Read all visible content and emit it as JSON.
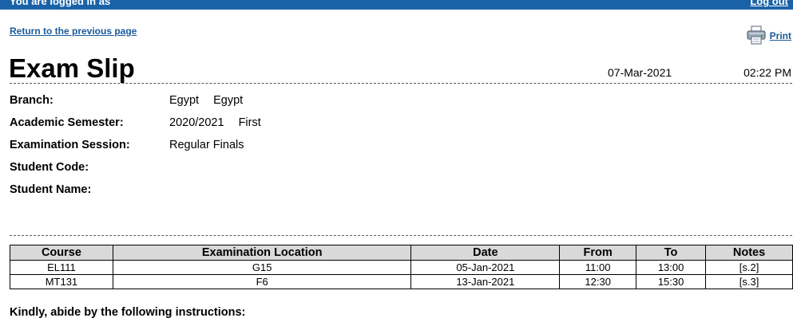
{
  "topbar": {
    "logged_in_text": "You are logged in as",
    "logout_label": "Log out",
    "color": "#1a62a8"
  },
  "nav": {
    "return_label": "Return to the previous page",
    "print_label": "Print",
    "print_icon": "printer-icon"
  },
  "header": {
    "title": "Exam Slip",
    "date": "07-Mar-2021",
    "time": "02:22 PM"
  },
  "info": {
    "branch": {
      "label": "Branch:",
      "values": [
        "Egypt",
        "Egypt"
      ]
    },
    "semester": {
      "label": "Academic Semester:",
      "values": [
        "2020/2021",
        "First"
      ]
    },
    "session": {
      "label": "Examination Session:",
      "values": [
        "Regular Finals"
      ]
    },
    "student_code": {
      "label": "Student Code:",
      "values": []
    },
    "student_name": {
      "label": "Student Name:",
      "values": []
    }
  },
  "table": {
    "columns": [
      "Course",
      "Examination Location",
      "Date",
      "From",
      "To",
      "Notes"
    ],
    "rows": [
      [
        "EL111",
        "G15",
        "05-Jan-2021",
        "11:00",
        "13:00",
        "[s.2]"
      ],
      [
        "MT131",
        "F6",
        "13-Jan-2021",
        "12:30",
        "15:30",
        "[s.3]"
      ]
    ]
  },
  "footer": {
    "instructions_heading": "Kindly, abide by the following instructions:"
  }
}
